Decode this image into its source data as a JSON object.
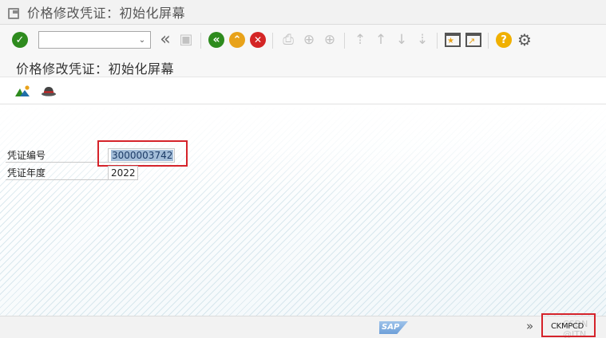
{
  "window": {
    "title": "价格修改凭证：初始化屏幕"
  },
  "toolbar": {
    "command_field_value": "",
    "icons": {
      "enter": "checkmark-icon",
      "dropdown": "chevron-down-icon",
      "expand": "double-chevron-left-icon",
      "save": "save-icon",
      "back": "back-icon",
      "exit": "exit-icon",
      "cancel": "cancel-icon",
      "print": "print-icon",
      "find": "find-icon",
      "find_next": "find-next-icon",
      "first_page": "first-page-icon",
      "previous_page": "previous-page-icon",
      "next_page": "next-page-icon",
      "last_page": "last-page-icon",
      "new_session": "new-session-icon",
      "shortcut": "shortcut-icon",
      "help": "help-icon",
      "settings": "gear-icon"
    },
    "glyphs": {
      "enter": "✓",
      "dropdown": "⌄",
      "expand": "«",
      "save": "▣",
      "back": "«",
      "exit": "⌃",
      "cancel": "✕",
      "print": "⎙",
      "find": "⊕",
      "find_next": "⊕",
      "first_page": "⇡",
      "previous_page": "↑",
      "next_page": "↓",
      "last_page": "⇣",
      "new_session": "★",
      "shortcut": "↗",
      "help": "?",
      "settings": "⚙"
    }
  },
  "screen": {
    "subtitle": "价格修改凭证：初始化屏幕",
    "app_icons": [
      "mountain-icon",
      "hat-icon"
    ]
  },
  "form": {
    "document_number": {
      "label": "凭证编号",
      "value": "3000003742"
    },
    "fiscal_year": {
      "label": "凭证年度",
      "value": "2022"
    }
  },
  "statusbar": {
    "logo": "SAP",
    "arrows": "»",
    "transaction": "CKMPCD",
    "watermark": "CSDN @ITN"
  },
  "colors": {
    "highlight_border": "#d5232a",
    "selection": "#a3bdd8",
    "enter_green": "#2e8b1e",
    "exit_orange": "#e8a21a",
    "cancel_red": "#d42525",
    "help_yellow": "#f0b000"
  }
}
